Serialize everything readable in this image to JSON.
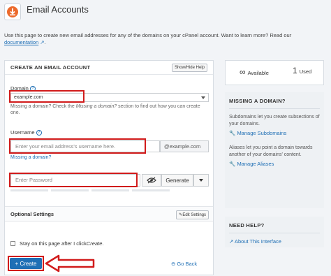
{
  "header": {
    "title": "Email Accounts"
  },
  "intro": {
    "text": "Use this page to create new email addresses for any of the domains on your cPanel account. Want to learn more? Read our",
    "link": "documentation"
  },
  "form": {
    "section_title": "CREATE AN EMAIL ACCOUNT",
    "show_hide_help": "Show/Hide Help",
    "domain": {
      "label": "Domain",
      "value": "example.com",
      "hint_prefix": "Missing a domain? Check the ",
      "hint_em": "Missing a domain?",
      "hint_suffix": " section to find out how you can create one."
    },
    "username": {
      "label": "Username",
      "placeholder": "Enter your email address's username here.",
      "suffix": "@example.com",
      "missing_link": "Missing a domain?"
    },
    "password": {
      "placeholder": "Enter Password",
      "generate": "Generate"
    },
    "optional": {
      "title": "Optional Settings",
      "edit": "Edit Settings"
    },
    "stay": {
      "text_prefix": "Stay on this page after I click ",
      "text_em": "Create",
      "text_suffix": "."
    },
    "create": "+ Create",
    "go_back": "Go Back"
  },
  "sidebar": {
    "available": "Available",
    "used_count": "1",
    "used": "Used",
    "missing": {
      "title": "MISSING A DOMAIN?",
      "sub_text": "Subdomains let you create subsections of your domains.",
      "sub_link": "Manage Subdomains",
      "alias_text": "Aliases let you point a domain towards another of your domains' content.",
      "alias_link": "Manage Aliases"
    },
    "help": {
      "title": "NEED HELP?",
      "link": "About This Interface"
    }
  },
  "colors": {
    "accent": "#1f6fb5",
    "highlight": "#d11b1b"
  }
}
